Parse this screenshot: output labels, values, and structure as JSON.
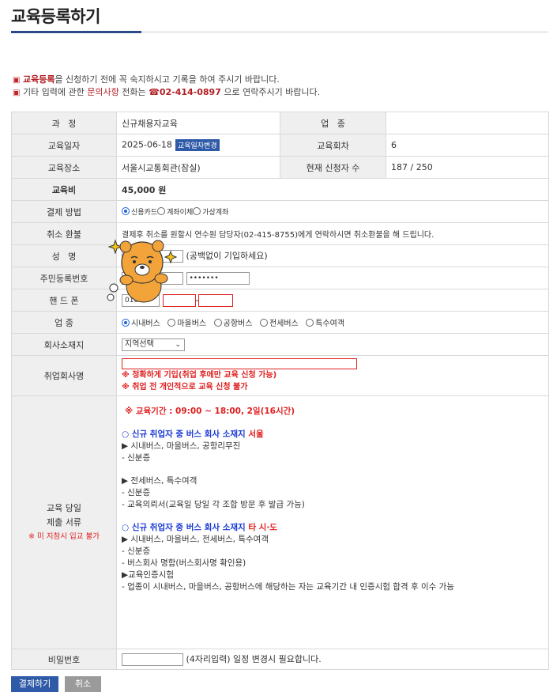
{
  "header": {
    "title": "교육등록하기"
  },
  "notices": {
    "line1_pre": "교육등록",
    "line1_post": "을 신청하기 전에 꼭 숙지하시고 기록을 하여 주시기 바랍니다.",
    "line2_pre": "기타 입력에 관한 ",
    "line2_hl": "문의사항",
    "line2_mid": " 전화는 ",
    "line2_phone": "☎02-414-0897",
    "line2_post": " 으로 연락주시기 바랍니다."
  },
  "form": {
    "course": {
      "label": "과   정",
      "value": "신규채용자교육"
    },
    "industry_top": {
      "label": "업   종",
      "value": ""
    },
    "date": {
      "label": "교육일자",
      "value": "2025-06-18",
      "change_btn": "교육일자변경"
    },
    "session": {
      "label": "교육회차",
      "value": "6"
    },
    "place": {
      "label": "교육장소",
      "value": "서울시교통회관(잠실)"
    },
    "applicants": {
      "label": "현재 신청자 수",
      "value": "187 / 250"
    },
    "fee": {
      "label": "교육비",
      "value": "45,000 원"
    },
    "payment": {
      "label": "결제 방법",
      "options": [
        "신용카드",
        "계좌이체",
        "가상계좌"
      ],
      "selected": "신용카드"
    },
    "refund": {
      "label": "취소 환불",
      "text": "결제후 취소를 원할시 연수원 담당자(02-415-8755)에게 연락하시면 취소환불을 해 드립니다."
    },
    "name": {
      "label": "성   명",
      "hint": "(공백없이 기입하세요)"
    },
    "rrn": {
      "label": "주민등록번호",
      "masked": "•••••••"
    },
    "phone": {
      "label": "핸 드 폰",
      "prefix": "010",
      "sep": "-"
    },
    "industry": {
      "label": "업 종",
      "options": [
        "시내버스",
        "마을버스",
        "공항버스",
        "전세버스",
        "특수여객"
      ],
      "selected": "시내버스"
    },
    "region": {
      "label": "회사소재지",
      "selected": "지역선택"
    },
    "company": {
      "label": "취업회사명",
      "note1": "※ 정확하게 기입(취업 후에만 교육 신청 가능)",
      "note2": "※ 취업 전 개인적으로 교육 신청 불가"
    },
    "docs": {
      "label1": "교육 당일",
      "label2": "제출 서류",
      "label_warn": "※ 미 지참시 입교 불가",
      "period": "※ 교육기간 : 09:00 ~ 18:00, 2일(16시간)",
      "seoul_pre": "○ 신규 취업자 중 버스 회사 소재지 ",
      "seoul_hl": "서울",
      "seoul_types1": "▶ 시내버스, 마을버스, 공항리무진",
      "seoul_id1": "- 신분증",
      "seoul_types2": "▶ 전세버스, 특수여객",
      "seoul_id2": "- 신분증",
      "seoul_req": "- 교육의뢰서(교육일 당일 각 조합 방문 후 발급 가능)",
      "other_pre": "○ 신규 취업자 중 버스 회사 소재지 ",
      "other_hl": "타 시·도",
      "other_types": "▶ 시내버스, 마을버스, 전세버스, 특수여객",
      "other_id": "- 신분증",
      "other_card": "- 버스회사 명함(버스회사명 확인용)",
      "cert_title": "▶교육인증시험",
      "cert_text": "- 업종이 시내버스, 마을버스, 공항버스에 해당하는 자는 교육기간 내 인증시험 합격 후 이수 가능"
    },
    "password": {
      "label": "비밀번호",
      "hint": "(4자리입력) 일정 변경시 필요합니다."
    }
  },
  "buttons": {
    "pay": "결제하기",
    "cancel": "취소"
  },
  "colors": {
    "accent": "#2c4a8a",
    "button_blue": "#2f5aa8",
    "warn_red": "#e02020",
    "label_bg": "#efefef"
  }
}
